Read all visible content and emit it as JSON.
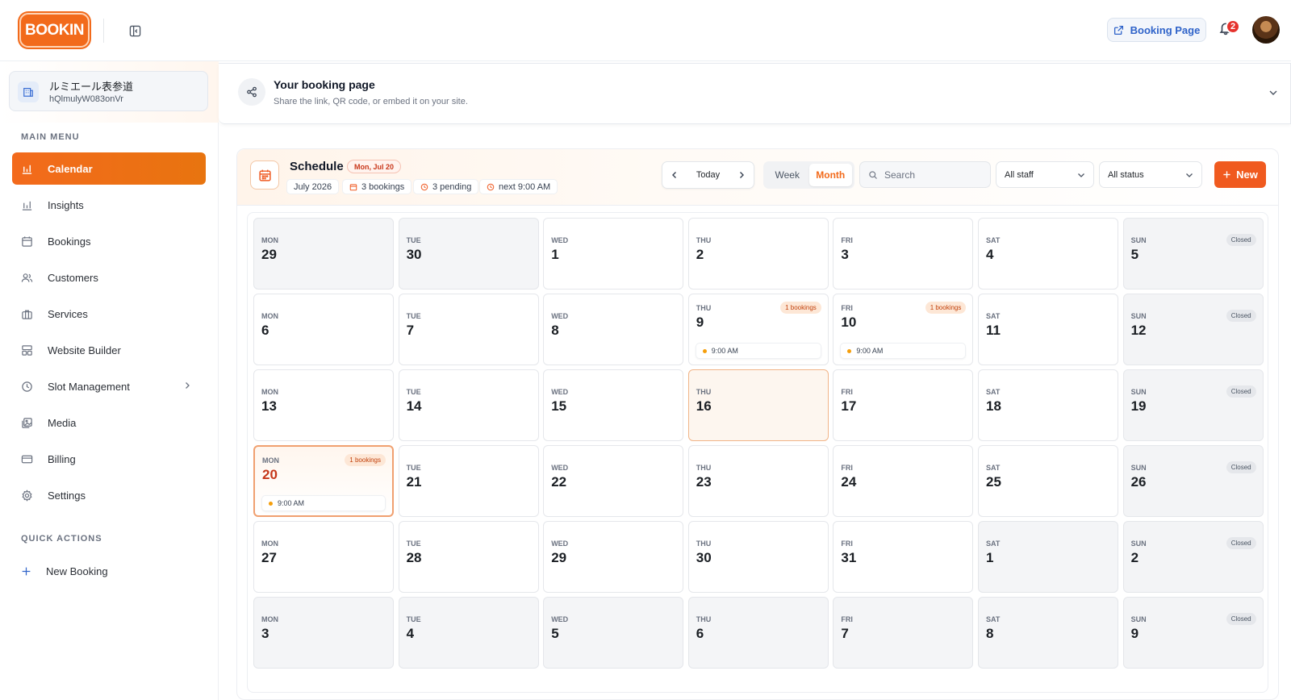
{
  "header": {
    "logo_text": "BOOKIN",
    "booking_page_label": "Booking Page",
    "notification_count": "2"
  },
  "sidebar": {
    "business": {
      "name": "ルミエール表参道",
      "id": "hQlmulyW083onVr"
    },
    "main_menu_label": "MAIN MENU",
    "items": [
      {
        "label": "Calendar",
        "icon": "bar-chart-icon",
        "active": true
      },
      {
        "label": "Insights",
        "icon": "insights-icon"
      },
      {
        "label": "Bookings",
        "icon": "calendar-icon"
      },
      {
        "label": "Customers",
        "icon": "users-icon"
      },
      {
        "label": "Services",
        "icon": "briefcase-icon"
      },
      {
        "label": "Website Builder",
        "icon": "layout-icon"
      },
      {
        "label": "Slot Management",
        "icon": "clock-icon"
      },
      {
        "label": "Media",
        "icon": "image-icon"
      },
      {
        "label": "Billing",
        "icon": "credit-card-icon"
      },
      {
        "label": "Settings",
        "icon": "gear-icon"
      }
    ],
    "quick_actions_label": "QUICK ACTIONS",
    "quick_actions": [
      {
        "label": "New Booking",
        "icon": "plus-icon"
      }
    ]
  },
  "booking_page_card": {
    "title": "Your booking page",
    "subtitle": "Share the link, QR code, or embed it on your site."
  },
  "schedule": {
    "title": "Schedule",
    "selected_date": "Mon, Jul 20",
    "month": "July 2026",
    "bookings_stat": "3 bookings",
    "pending_stat": "3 pending",
    "next_stat": "next 9:00 AM",
    "today_label": "Today",
    "views": [
      "Week",
      "Month"
    ],
    "active_view": "Month",
    "search_placeholder": "Search",
    "staff_filter": "All staff",
    "status_filter": "All status",
    "new_label": "New",
    "accent_color": "#f26a1b"
  },
  "calendar": {
    "closed_label": "Closed",
    "weeks": [
      [
        {
          "dow": "MON",
          "day": "29",
          "other": true
        },
        {
          "dow": "TUE",
          "day": "30",
          "other": true
        },
        {
          "dow": "WED",
          "day": "1"
        },
        {
          "dow": "THU",
          "day": "2"
        },
        {
          "dow": "FRI",
          "day": "3"
        },
        {
          "dow": "SAT",
          "day": "4"
        },
        {
          "dow": "SUN",
          "day": "5",
          "closed": true
        }
      ],
      [
        {
          "dow": "MON",
          "day": "6"
        },
        {
          "dow": "TUE",
          "day": "7"
        },
        {
          "dow": "WED",
          "day": "8"
        },
        {
          "dow": "THU",
          "day": "9",
          "bookings": "1 bookings",
          "slot": "9:00 AM"
        },
        {
          "dow": "FRI",
          "day": "10",
          "bookings": "1 bookings",
          "slot": "9:00 AM"
        },
        {
          "dow": "SAT",
          "day": "11"
        },
        {
          "dow": "SUN",
          "day": "12",
          "closed": true
        }
      ],
      [
        {
          "dow": "MON",
          "day": "13"
        },
        {
          "dow": "TUE",
          "day": "14"
        },
        {
          "dow": "WED",
          "day": "15"
        },
        {
          "dow": "THU",
          "day": "16",
          "today": true
        },
        {
          "dow": "FRI",
          "day": "17"
        },
        {
          "dow": "SAT",
          "day": "18"
        },
        {
          "dow": "SUN",
          "day": "19",
          "closed": true
        }
      ],
      [
        {
          "dow": "MON",
          "day": "20",
          "selected": true,
          "bookings": "1 bookings",
          "slot": "9:00 AM"
        },
        {
          "dow": "TUE",
          "day": "21"
        },
        {
          "dow": "WED",
          "day": "22"
        },
        {
          "dow": "THU",
          "day": "23"
        },
        {
          "dow": "FRI",
          "day": "24"
        },
        {
          "dow": "SAT",
          "day": "25"
        },
        {
          "dow": "SUN",
          "day": "26",
          "closed": true
        }
      ],
      [
        {
          "dow": "MON",
          "day": "27"
        },
        {
          "dow": "TUE",
          "day": "28"
        },
        {
          "dow": "WED",
          "day": "29"
        },
        {
          "dow": "THU",
          "day": "30"
        },
        {
          "dow": "FRI",
          "day": "31"
        },
        {
          "dow": "SAT",
          "day": "1",
          "other": true
        },
        {
          "dow": "SUN",
          "day": "2",
          "closed": true,
          "other": true
        }
      ],
      [
        {
          "dow": "MON",
          "day": "3",
          "other": true
        },
        {
          "dow": "TUE",
          "day": "4",
          "other": true
        },
        {
          "dow": "WED",
          "day": "5",
          "other": true
        },
        {
          "dow": "THU",
          "day": "6",
          "other": true
        },
        {
          "dow": "FRI",
          "day": "7",
          "other": true
        },
        {
          "dow": "SAT",
          "day": "8",
          "other": true
        },
        {
          "dow": "SUN",
          "day": "9",
          "closed": true,
          "other": true
        }
      ]
    ]
  }
}
